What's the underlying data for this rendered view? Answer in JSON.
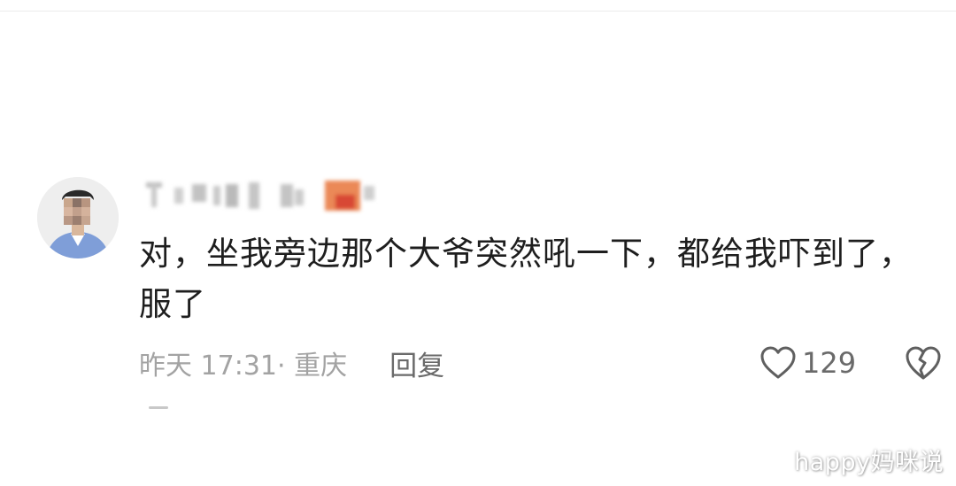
{
  "comment": {
    "text": "对，坐我旁边那个大爷突然吼一下，都给我吓到了，服了",
    "time_location": "昨天 17:31· 重庆",
    "reply_label": "回复",
    "like_count": "129"
  },
  "icons": {
    "avatar": "user-avatar-pixelated",
    "like": "heart-outline-icon",
    "dislike": "broken-heart-icon"
  },
  "colors": {
    "text": "#1e1e1e",
    "meta": "#a3a3a3",
    "action": "#6a6a6a",
    "username_accent": "#e8743b"
  },
  "watermark": "happy妈咪说"
}
